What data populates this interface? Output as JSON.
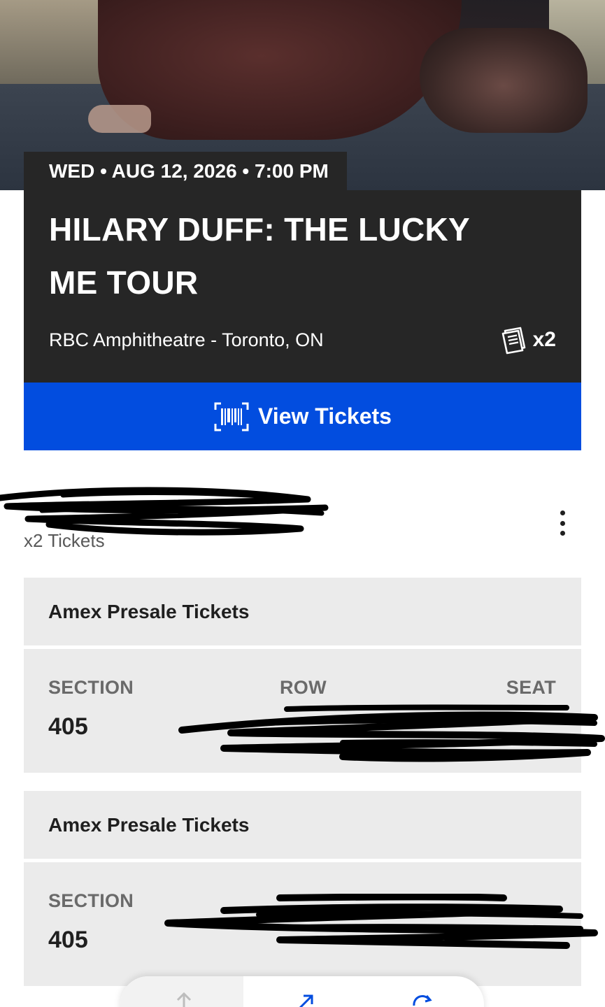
{
  "event": {
    "date_line": "WED • AUG 12, 2026 • 7:00 PM",
    "title": "HILARY DUFF: THE LUCKY ME TOUR",
    "venue": "RBC Amphitheatre - Toronto, ON",
    "ticket_count": "x2"
  },
  "actions": {
    "view_tickets": "View Tickets"
  },
  "order": {
    "tickets_label": "x2 Tickets"
  },
  "tickets": [
    {
      "group_label": "Amex Presale Tickets",
      "section_label": "SECTION",
      "section": "405",
      "row_label": "ROW",
      "seat_label": "SEAT"
    },
    {
      "group_label": "Amex Presale Tickets",
      "section_label": "SECTION",
      "section": "405"
    }
  ],
  "colors": {
    "card_dark": "#262626",
    "primary_blue": "#024ddf",
    "panel_gray": "#ebebeb"
  },
  "icons": [
    "hero-image",
    "ticket-stack-icon",
    "barcode-icon",
    "more-vertical-icon",
    "upload-icon",
    "external-link-icon",
    "refresh-icon"
  ]
}
